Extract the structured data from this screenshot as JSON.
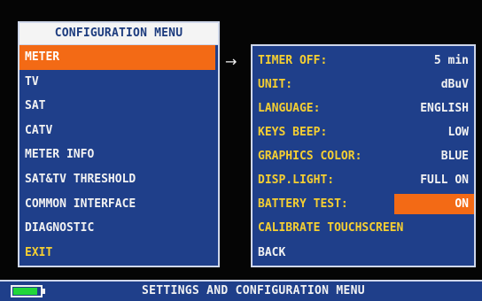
{
  "config_menu": {
    "title": "CONFIGURATION MENU",
    "items": [
      {
        "label": "METER",
        "state": "selected"
      },
      {
        "label": "TV"
      },
      {
        "label": "SAT"
      },
      {
        "label": "CATV"
      },
      {
        "label": "METER INFO"
      },
      {
        "label": "SAT&TV THRESHOLD"
      },
      {
        "label": "COMMON INTERFACE"
      },
      {
        "label": "DIAGNOSTIC"
      },
      {
        "label": "EXIT"
      }
    ]
  },
  "arrow": "→",
  "meter_settings": {
    "rows": [
      {
        "label": "TIMER OFF:",
        "value": "5 min"
      },
      {
        "label": "UNIT:",
        "value": "dBuV"
      },
      {
        "label": "LANGUAGE:",
        "value": "ENGLISH"
      },
      {
        "label": "KEYS BEEP:",
        "value": "LOW"
      },
      {
        "label": "GRAPHICS COLOR:",
        "value": "BLUE"
      },
      {
        "label": "DISP.LIGHT:",
        "value": "FULL ON"
      },
      {
        "label": "BATTERY TEST:",
        "value": "ON",
        "state": "selected"
      }
    ],
    "calibrate_label": "CALIBRATE TOUCHSCREEN",
    "back_label": "BACK"
  },
  "status_bar": {
    "text": "SETTINGS AND CONFIGURATION MENU",
    "battery_level": 0.9,
    "battery_icon": "battery-icon"
  },
  "colors": {
    "panel_bg": "#1f3f8a",
    "highlight": "#f36a15",
    "label_yellow": "#f5cf32",
    "battery_green": "#22d63a"
  }
}
